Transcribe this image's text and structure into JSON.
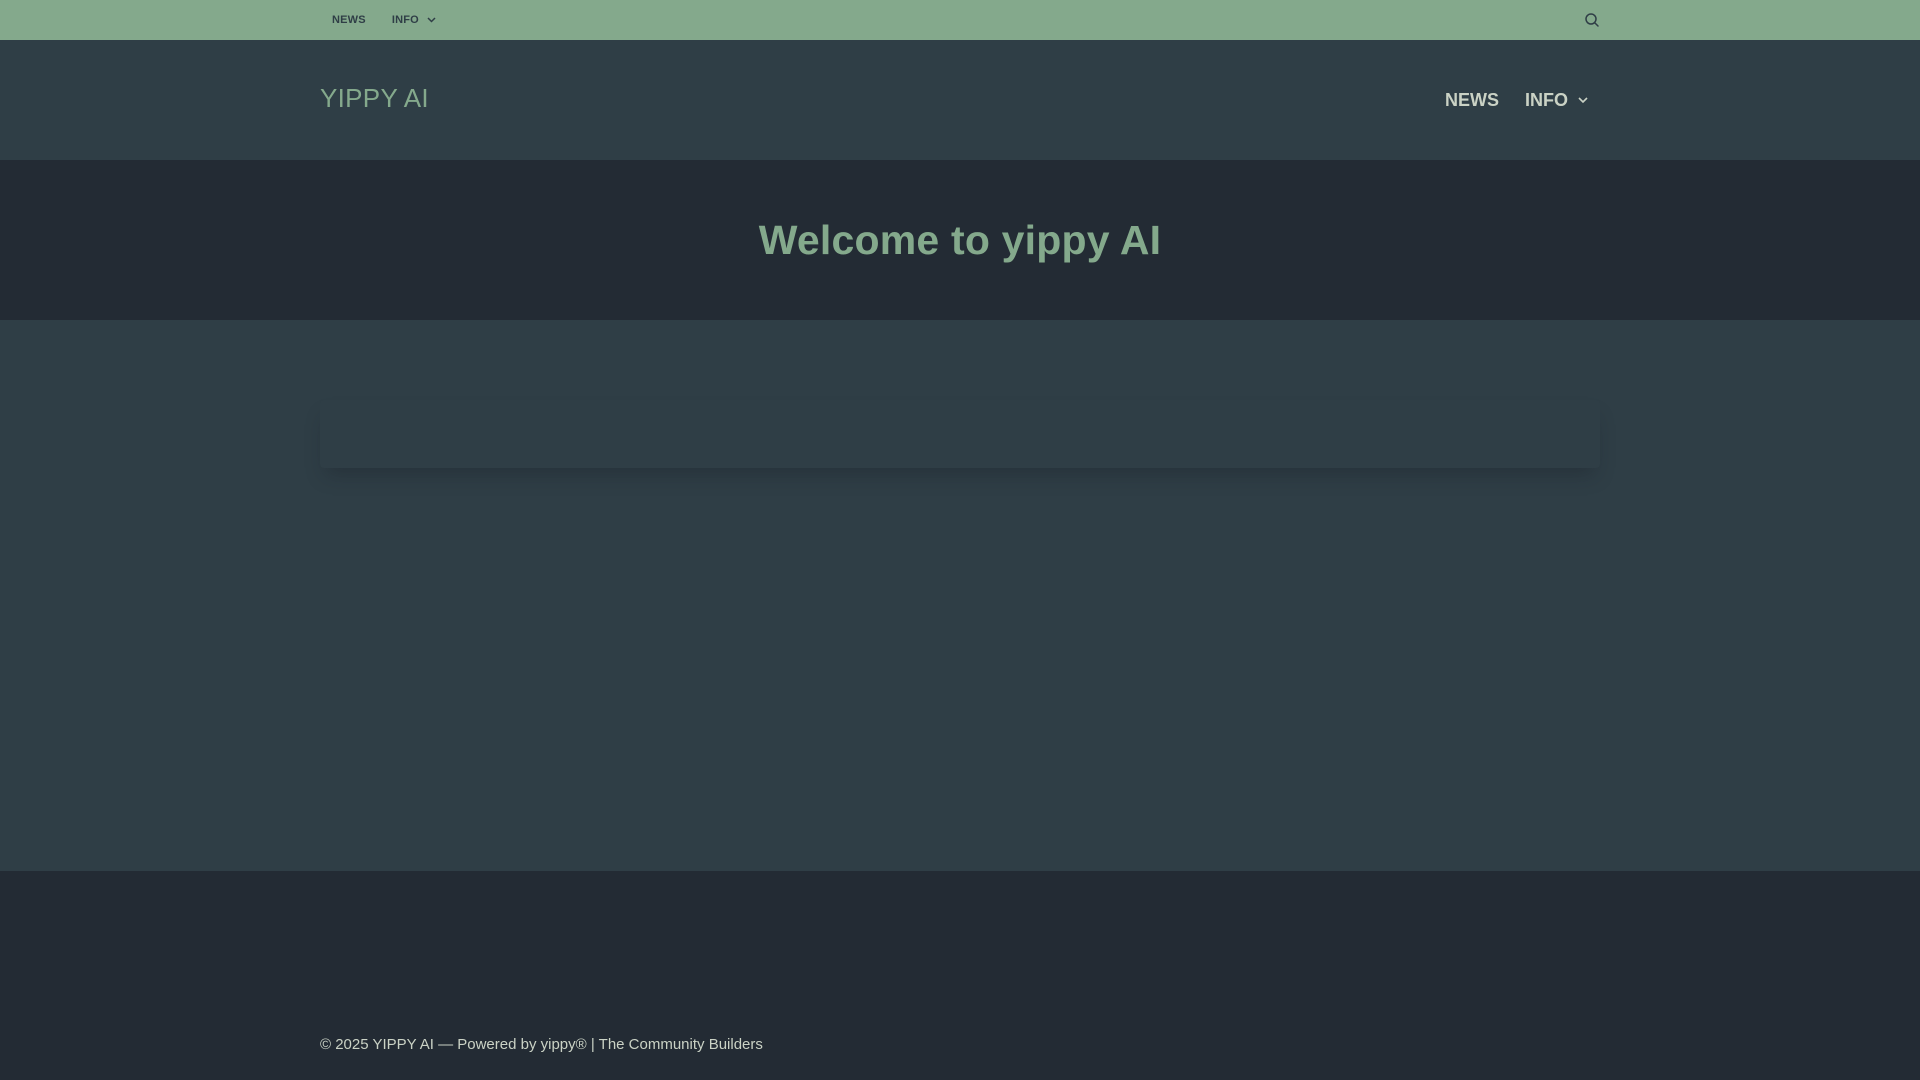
{
  "colors": {
    "topbar_bg": "#84a98c",
    "header_bg": "#2f3e46",
    "hero_bg": "#232b34",
    "content_bg": "#2f3e46",
    "footer_bg": "#232b34",
    "accent": "#84a98c",
    "text_light": "#cad2c5"
  },
  "topbar": {
    "nav": [
      {
        "label": "NEWS"
      },
      {
        "label": "INFO",
        "icon": "chevron-down-icon"
      }
    ],
    "search_icon": "search-icon"
  },
  "header": {
    "site_title": "YIPPY AI",
    "nav": [
      {
        "label": "NEWS"
      },
      {
        "label": "INFO",
        "icon": "chevron-down-icon"
      }
    ]
  },
  "hero": {
    "title": "Welcome to yippy AI"
  },
  "footer": {
    "copyright": "© 2025 YIPPY AI — Powered by yippy® | The Community Builders"
  }
}
